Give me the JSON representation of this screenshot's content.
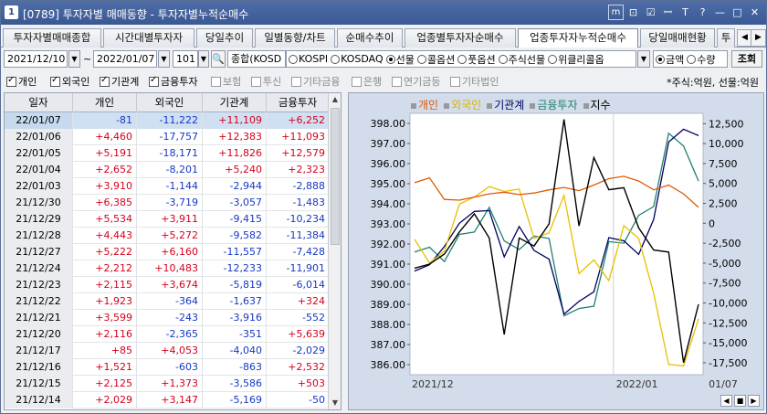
{
  "window": {
    "number": "1",
    "title": "[0789] 투자자별 매매동향 - 투자자별누적순매수",
    "buttons": [
      "m",
      "⊡",
      "☑",
      "ꟷ",
      "T",
      "?",
      "—",
      "□",
      "✕"
    ]
  },
  "tabs": [
    {
      "label": "투자자별매매종합"
    },
    {
      "label": "시간대별투자자"
    },
    {
      "label": "당일추이"
    },
    {
      "label": "일별동향/차트"
    },
    {
      "label": "순매수추이"
    },
    {
      "label": "업종별투자자순매수"
    },
    {
      "label": "업종투자자누적순매수"
    },
    {
      "label": "당일매매현황"
    },
    {
      "label": "투"
    }
  ],
  "toolbar": {
    "start_date": "2021/12/10",
    "range_sep": "~",
    "end_date": "2022/01/07",
    "code": "101",
    "market_select": "종합(KOSD",
    "market_radios": [
      {
        "label": "KOSPI",
        "on": false
      },
      {
        "label": "KOSDAQ",
        "on": false
      },
      {
        "label": "선물",
        "on": true
      },
      {
        "label": "콜옵션",
        "on": false
      },
      {
        "label": "풋옵션",
        "on": false
      },
      {
        "label": "주식선물",
        "on": false
      },
      {
        "label": "위클리콜옵",
        "on": false
      }
    ],
    "value_radios": [
      {
        "label": "금액",
        "on": true
      },
      {
        "label": "수량",
        "on": false
      }
    ],
    "query_label": "조회"
  },
  "filters": [
    {
      "label": "개인",
      "on": true,
      "enabled": true
    },
    {
      "label": "외국인",
      "on": true,
      "enabled": true
    },
    {
      "label": "기관계",
      "on": true,
      "enabled": true
    },
    {
      "label": "금융투자",
      "on": true,
      "enabled": true
    },
    {
      "label": "보험",
      "on": false,
      "enabled": false
    },
    {
      "label": "투신",
      "on": false,
      "enabled": false
    },
    {
      "label": "기타금융",
      "on": false,
      "enabled": false
    },
    {
      "label": "은행",
      "on": false,
      "enabled": false
    },
    {
      "label": "연기금등",
      "on": false,
      "enabled": false
    },
    {
      "label": "기타법인",
      "on": false,
      "enabled": false
    }
  ],
  "unit_note": "*주식:억원, 선물:억원",
  "table": {
    "headers": [
      "일자",
      "개인",
      "외국인",
      "기관계",
      "금융투자"
    ],
    "rows": [
      [
        "22/01/07",
        "-81",
        "-11,222",
        "+11,109",
        "+6,252"
      ],
      [
        "22/01/06",
        "+4,460",
        "-17,757",
        "+12,383",
        "+11,093"
      ],
      [
        "22/01/05",
        "+5,191",
        "-18,171",
        "+11,826",
        "+12,579"
      ],
      [
        "22/01/04",
        "+2,652",
        "-8,201",
        "+5,240",
        "+2,323"
      ],
      [
        "22/01/03",
        "+3,910",
        "-1,144",
        "-2,944",
        "-2,888"
      ],
      [
        "21/12/30",
        "+6,385",
        "-3,719",
        "-3,057",
        "-1,483"
      ],
      [
        "21/12/29",
        "+5,534",
        "+3,911",
        "-9,415",
        "-10,234"
      ],
      [
        "21/12/28",
        "+4,443",
        "+5,272",
        "-9,582",
        "-11,384"
      ],
      [
        "21/12/27",
        "+5,222",
        "+6,160",
        "-11,557",
        "-7,428"
      ],
      [
        "21/12/24",
        "+2,212",
        "+10,483",
        "-12,233",
        "-11,901"
      ],
      [
        "21/12/23",
        "+2,115",
        "+3,674",
        "-5,819",
        "-6,014"
      ],
      [
        "21/12/22",
        "+1,923",
        "-364",
        "-1,637",
        "+324"
      ],
      [
        "21/12/21",
        "+3,599",
        "-243",
        "-3,916",
        "-552"
      ],
      [
        "21/12/20",
        "+2,116",
        "-2,365",
        "-351",
        "+5,639"
      ],
      [
        "21/12/17",
        "+85",
        "+4,053",
        "-4,040",
        "-2,029"
      ],
      [
        "21/12/16",
        "+1,521",
        "-603",
        "-863",
        "+2,532"
      ],
      [
        "21/12/15",
        "+2,125",
        "+1,373",
        "-3,586",
        "+503"
      ],
      [
        "21/12/14",
        "+2,029",
        "+3,147",
        "-5,169",
        "-50"
      ]
    ]
  },
  "chart_data": {
    "type": "line",
    "legend": [
      "개인",
      "외국인",
      "기관계",
      "금융투자",
      "지수"
    ],
    "colors": {
      "개인": "#e05a00",
      "외국인": "#e8c000",
      "기관계": "#000060",
      "금융투자": "#1f8070",
      "지수": "#000000"
    },
    "left_axis": {
      "ticks": [
        "398.00",
        "397.00",
        "396.00",
        "395.00",
        "394.00",
        "393.00",
        "392.00",
        "391.00",
        "390.00",
        "389.00",
        "388.00",
        "387.00",
        "386.00"
      ],
      "min": 385.5,
      "max": 398.5
    },
    "right_axis": {
      "ticks": [
        "12,500",
        "10,000",
        "7,500",
        "5,000",
        "2,500",
        "0",
        "-2,500",
        "-5,000",
        "-7,500",
        "-10,000",
        "-12,500",
        "-15,000",
        "-17,500"
      ],
      "min": -19000,
      "max": 13800
    },
    "x_labels": [
      "2021/12",
      "2022/01",
      "01/07"
    ],
    "series_cum": {
      "개인": [
        5100,
        5700,
        3000,
        2900,
        3300,
        3700,
        3900,
        3600,
        3800,
        4200,
        4500,
        4100,
        4800,
        5600,
        5900,
        5300,
        4200,
        4800,
        3700,
        2000
      ],
      "외국인": [
        -2000,
        -5000,
        -3500,
        2400,
        3300,
        4600,
        4000,
        4300,
        -1900,
        -1200,
        3500,
        -6300,
        -4600,
        -7200,
        -300,
        -1900,
        -8800,
        -17700,
        -17900,
        -12000
      ],
      "기관계": [
        -6000,
        -5200,
        -2900,
        0,
        1500,
        1600,
        -4200,
        -400,
        -3400,
        -4500,
        -11400,
        -9800,
        -8600,
        -1800,
        -2200,
        -3900,
        500,
        10200,
        11800,
        11000
      ],
      "금융투자": [
        -3600,
        -3000,
        -4800,
        -1400,
        -1100,
        2000,
        -2200,
        -3300,
        -1600,
        -1900,
        -11600,
        -10700,
        -10400,
        -2300,
        -2500,
        1000,
        2100,
        11300,
        9700,
        5300
      ]
    },
    "index": [
      390.8,
      391.0,
      391.5,
      392.6,
      393.5,
      392.3,
      387.5,
      392.3,
      391.9,
      393.0,
      398.2,
      392.9,
      396.3,
      394.7,
      394.8,
      392.8,
      391.7,
      391.6,
      386.1,
      389.0
    ]
  }
}
